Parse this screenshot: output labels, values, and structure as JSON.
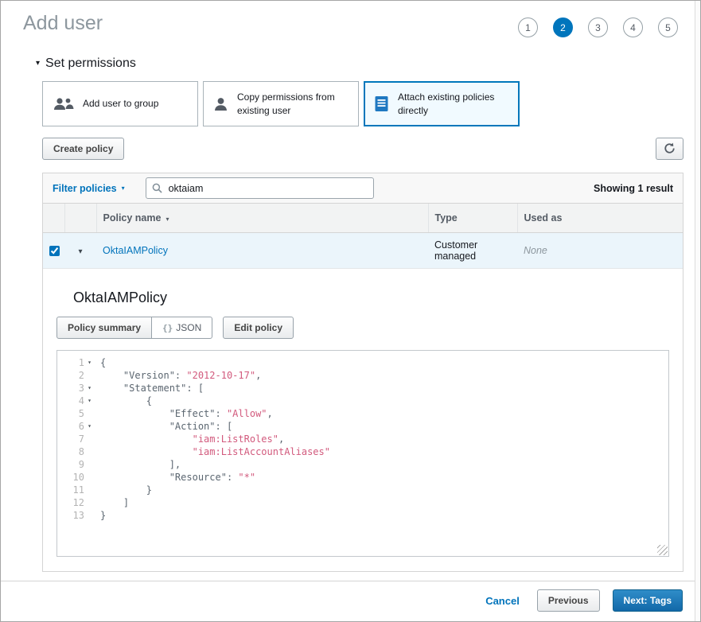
{
  "page": {
    "title": "Add user"
  },
  "glyphs": {
    "caret_down": "▾",
    "sort_down": "▾",
    "chevron_down": "▾"
  },
  "colors": {
    "accent_blue": "#0073bb",
    "active_step_blue": "#0075bc",
    "selected_card_bg": "#f1faff",
    "selected_row_bg": "#ebf5fb",
    "string_token": "#d25a7d"
  },
  "steps": [
    {
      "label": "1",
      "active": false
    },
    {
      "label": "2",
      "active": true
    },
    {
      "label": "3",
      "active": false
    },
    {
      "label": "4",
      "active": false
    },
    {
      "label": "5",
      "active": false
    }
  ],
  "permissions": {
    "section_title": "Set permissions",
    "cards": [
      {
        "label": "Add user to group",
        "icon": "group-icon",
        "selected": false
      },
      {
        "label": "Copy permissions from existing user",
        "icon": "user-icon",
        "selected": false
      },
      {
        "label": "Attach existing policies directly",
        "icon": "policy-document-icon",
        "selected": true
      }
    ]
  },
  "toolbar": {
    "create_policy_label": "Create policy",
    "refresh_icon": "refresh-icon"
  },
  "filter_bar": {
    "filter_label": "Filter policies",
    "search_icon": "magnifier-icon",
    "search_value": "oktaiam",
    "results_text": "Showing 1 result"
  },
  "policy_table": {
    "columns": [
      "Policy name",
      "Type",
      "Used as"
    ],
    "rows": [
      {
        "name": "OktaIAMPolicy",
        "type": "Customer managed",
        "used_as": "None",
        "checked": true,
        "expanded": true
      }
    ]
  },
  "policy_detail": {
    "title": "OktaIAMPolicy",
    "tabs": [
      {
        "label": "Policy summary",
        "active": true
      },
      {
        "label": "JSON",
        "icon_text": "{}",
        "active": false
      },
      {
        "label": "Edit policy",
        "active": false
      }
    ],
    "code_lines": [
      {
        "num": "1",
        "fold": true,
        "segments": [
          {
            "t": "p",
            "s": "{"
          }
        ]
      },
      {
        "num": "2",
        "fold": false,
        "segments": [
          {
            "t": "p",
            "s": "    \"Version\": "
          },
          {
            "t": "str",
            "s": "\"2012-10-17\""
          },
          {
            "t": "p",
            "s": ","
          }
        ]
      },
      {
        "num": "3",
        "fold": true,
        "segments": [
          {
            "t": "p",
            "s": "    \"Statement\": ["
          }
        ]
      },
      {
        "num": "4",
        "fold": true,
        "segments": [
          {
            "t": "p",
            "s": "        {"
          }
        ]
      },
      {
        "num": "5",
        "fold": false,
        "segments": [
          {
            "t": "p",
            "s": "            \"Effect\": "
          },
          {
            "t": "str",
            "s": "\"Allow\""
          },
          {
            "t": "p",
            "s": ","
          }
        ]
      },
      {
        "num": "6",
        "fold": true,
        "segments": [
          {
            "t": "p",
            "s": "            \"Action\": ["
          }
        ]
      },
      {
        "num": "7",
        "fold": false,
        "segments": [
          {
            "t": "p",
            "s": "                "
          },
          {
            "t": "str",
            "s": "\"iam:ListRoles\""
          },
          {
            "t": "p",
            "s": ","
          }
        ]
      },
      {
        "num": "8",
        "fold": false,
        "segments": [
          {
            "t": "p",
            "s": "                "
          },
          {
            "t": "str",
            "s": "\"iam:ListAccountAliases\""
          }
        ]
      },
      {
        "num": "9",
        "fold": false,
        "segments": [
          {
            "t": "p",
            "s": "            ],"
          }
        ]
      },
      {
        "num": "10",
        "fold": false,
        "segments": [
          {
            "t": "p",
            "s": "            \"Resource\": "
          },
          {
            "t": "str",
            "s": "\"*\""
          }
        ]
      },
      {
        "num": "11",
        "fold": false,
        "segments": [
          {
            "t": "p",
            "s": "        }"
          }
        ]
      },
      {
        "num": "12",
        "fold": false,
        "segments": [
          {
            "t": "p",
            "s": "    ]"
          }
        ]
      },
      {
        "num": "13",
        "fold": false,
        "segments": [
          {
            "t": "p",
            "s": "}"
          }
        ]
      }
    ]
  },
  "footer": {
    "cancel_label": "Cancel",
    "previous_label": "Previous",
    "next_label": "Next: Tags"
  }
}
